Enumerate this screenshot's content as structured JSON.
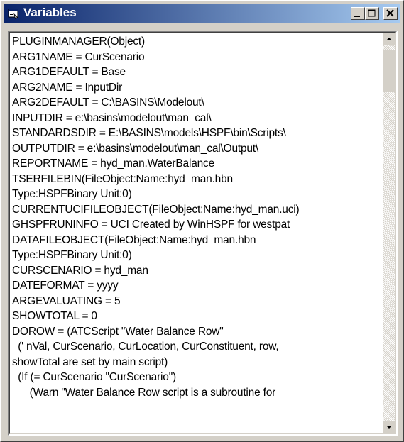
{
  "window": {
    "title": "Variables"
  },
  "titlebar_icons": [
    "window-icon",
    "minimize-icon",
    "maximize-icon",
    "close-icon"
  ],
  "scrollbar": {
    "position": 0.0
  },
  "lines": [
    "PLUGINMANAGER(Object)",
    "ARG1NAME = CurScenario",
    "ARG1DEFAULT = Base",
    "ARG2NAME = InputDir",
    "ARG2DEFAULT = C:\\BASINS\\Modelout\\",
    "INPUTDIR = e:\\basins\\modelout\\man_cal\\",
    "STANDARDSDIR = E:\\BASINS\\models\\HSPF\\bin\\Scripts\\",
    "OUTPUTDIR = e:\\basins\\modelout\\man_cal\\Output\\",
    "REPORTNAME = hyd_man.WaterBalance",
    "TSERFILEBIN(FileObject:Name:hyd_man.hbn",
    "Type:HSPFBinary Unit:0)",
    "CURRENTUCIFILEOBJECT(FileObject:Name:hyd_man.uci)",
    "GHSPFRUNINFO = UCI Created by WinHSPF for westpat",
    "DATAFILEOBJECT(FileObject:Name:hyd_man.hbn",
    "Type:HSPFBinary Unit:0)",
    "CURSCENARIO = hyd_man",
    "DATEFORMAT = yyyy",
    "ARGEVALUATING = 5",
    "SHOWTOTAL = 0",
    "DOROW = (ATCScript \"Water Balance Row\"",
    "  (' nVal, CurScenario, CurLocation, CurConstituent, row,",
    "showTotal are set by main script)",
    "  (If (= CurScenario \"CurScenario\")",
    "      (Warn \"Water Balance Row script is a subroutine for"
  ]
}
